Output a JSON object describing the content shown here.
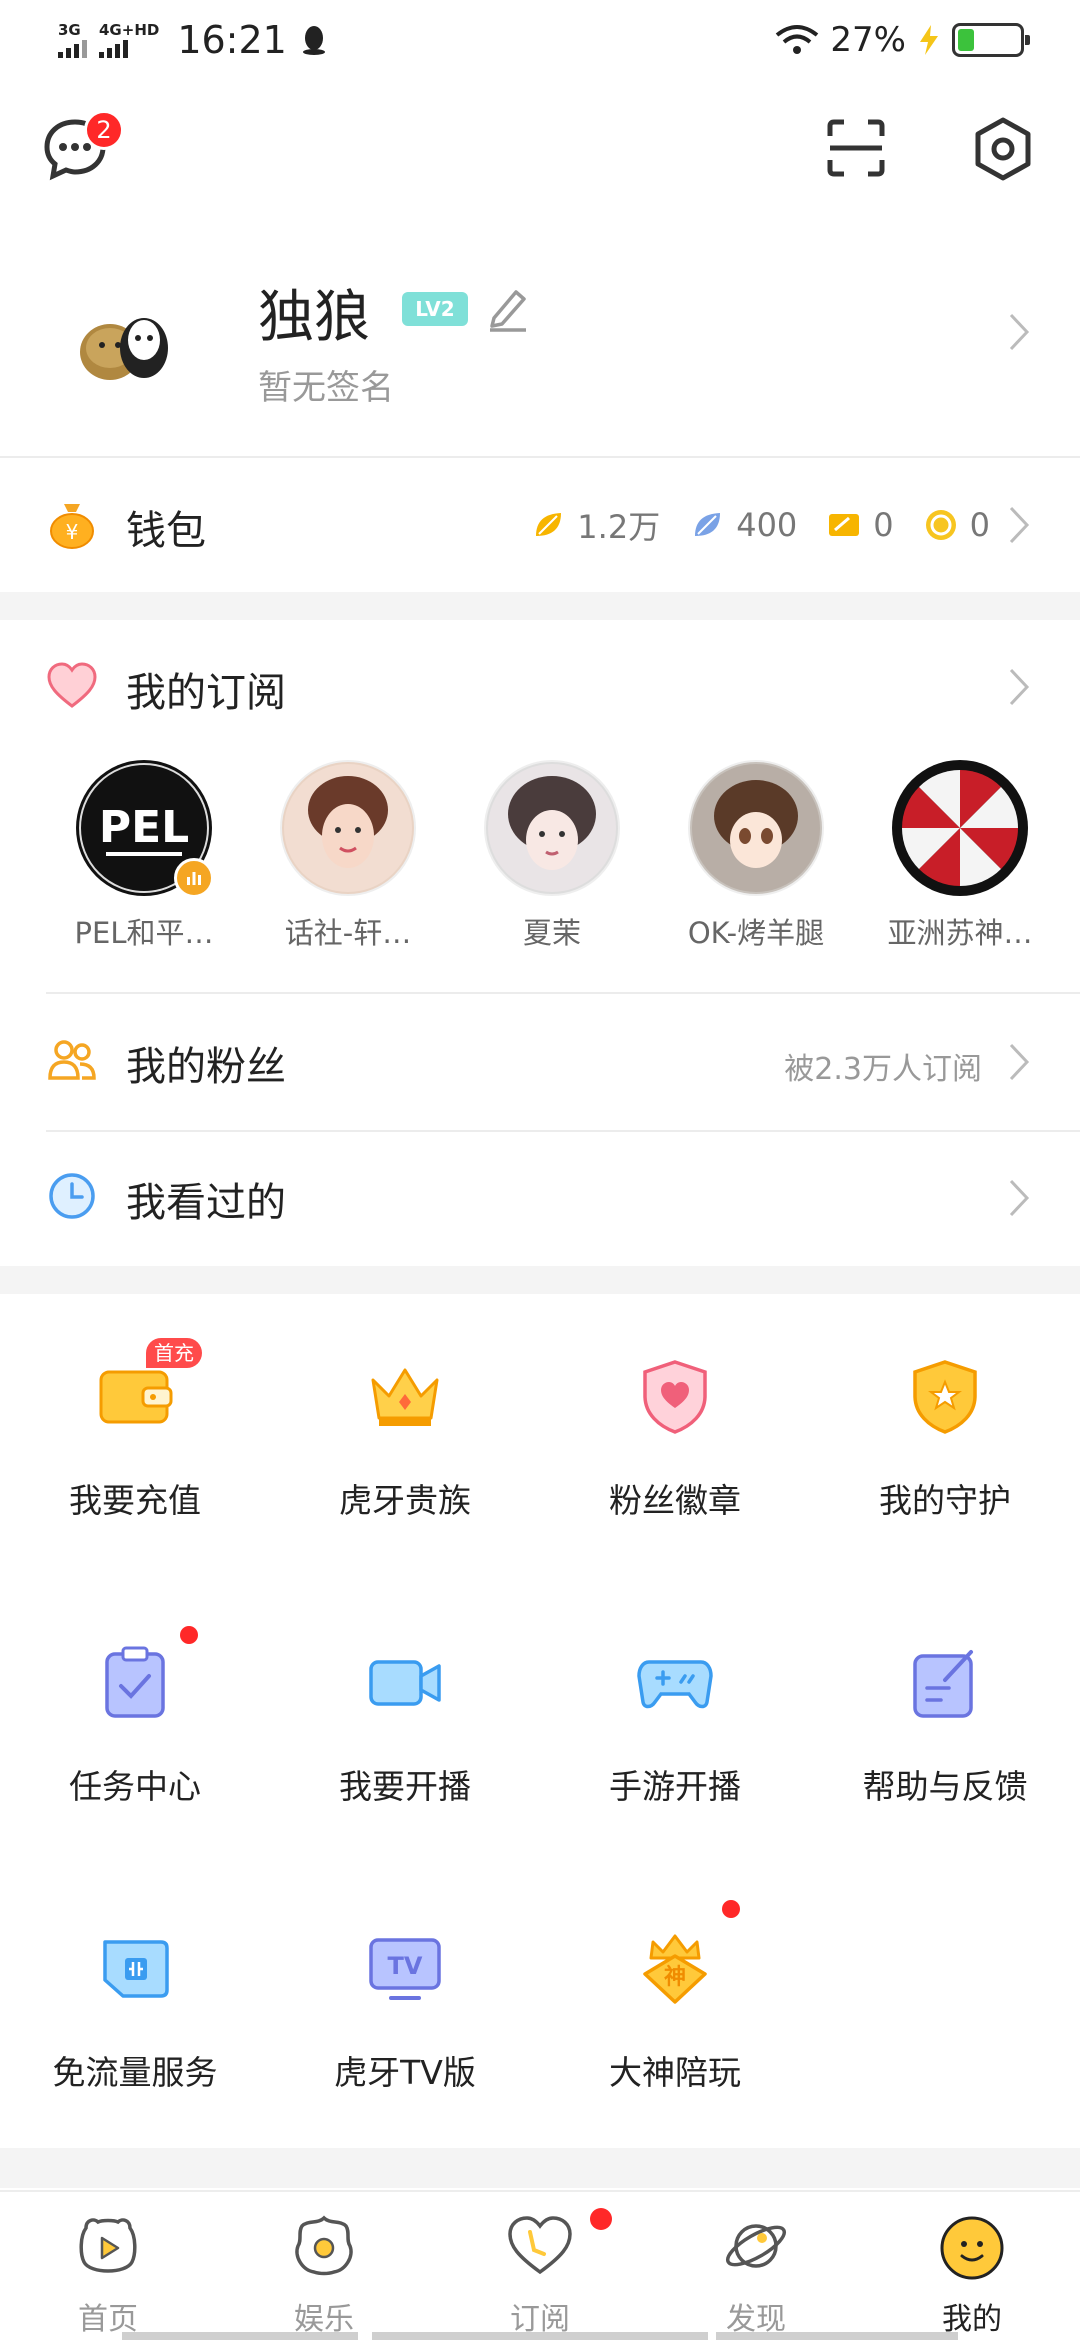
{
  "status_bar": {
    "net1": "3G",
    "net2": "4G+HD",
    "time": "16:21",
    "battery_pct": "27%",
    "battery_level": 0.27
  },
  "topbar": {
    "message_badge": "2"
  },
  "profile": {
    "name": "独狼",
    "level": "LV2",
    "signature": "暂无签名"
  },
  "wallet": {
    "title": "钱包",
    "stat1": "1.2万",
    "stat2": "400",
    "stat3": "0",
    "stat4": "0"
  },
  "subscriptions": {
    "title": "我的订阅",
    "items": [
      {
        "label": "PEL和平…"
      },
      {
        "label": "话社-轩…"
      },
      {
        "label": "夏茉"
      },
      {
        "label": "OK-烤羊腿"
      },
      {
        "label": "亚洲苏神…"
      }
    ],
    "pel_logo_text": "PEL"
  },
  "fans": {
    "title": "我的粉丝",
    "count_text": "被2.3万人订阅"
  },
  "history": {
    "title": "我看过的"
  },
  "grid": {
    "items": [
      {
        "label": "我要充值",
        "badge": "首充"
      },
      {
        "label": "虎牙贵族"
      },
      {
        "label": "粉丝徽章"
      },
      {
        "label": "我的守护"
      },
      {
        "label": "任务中心"
      },
      {
        "label": "我要开播"
      },
      {
        "label": "手游开播"
      },
      {
        "label": "帮助与反馈"
      },
      {
        "label": "免流量服务"
      },
      {
        "label": "虎牙TV版",
        "icon_text": "TV"
      },
      {
        "label": "大神陪玩",
        "icon_text": "神"
      }
    ]
  },
  "bottom_nav": {
    "items": [
      {
        "label": "首页"
      },
      {
        "label": "娱乐"
      },
      {
        "label": "订阅"
      },
      {
        "label": "发现"
      },
      {
        "label": "我的"
      }
    ]
  },
  "colors": {
    "accent_orange": "#f5a623",
    "badge_red": "#ff2828",
    "level_teal": "#7fe0d8"
  }
}
